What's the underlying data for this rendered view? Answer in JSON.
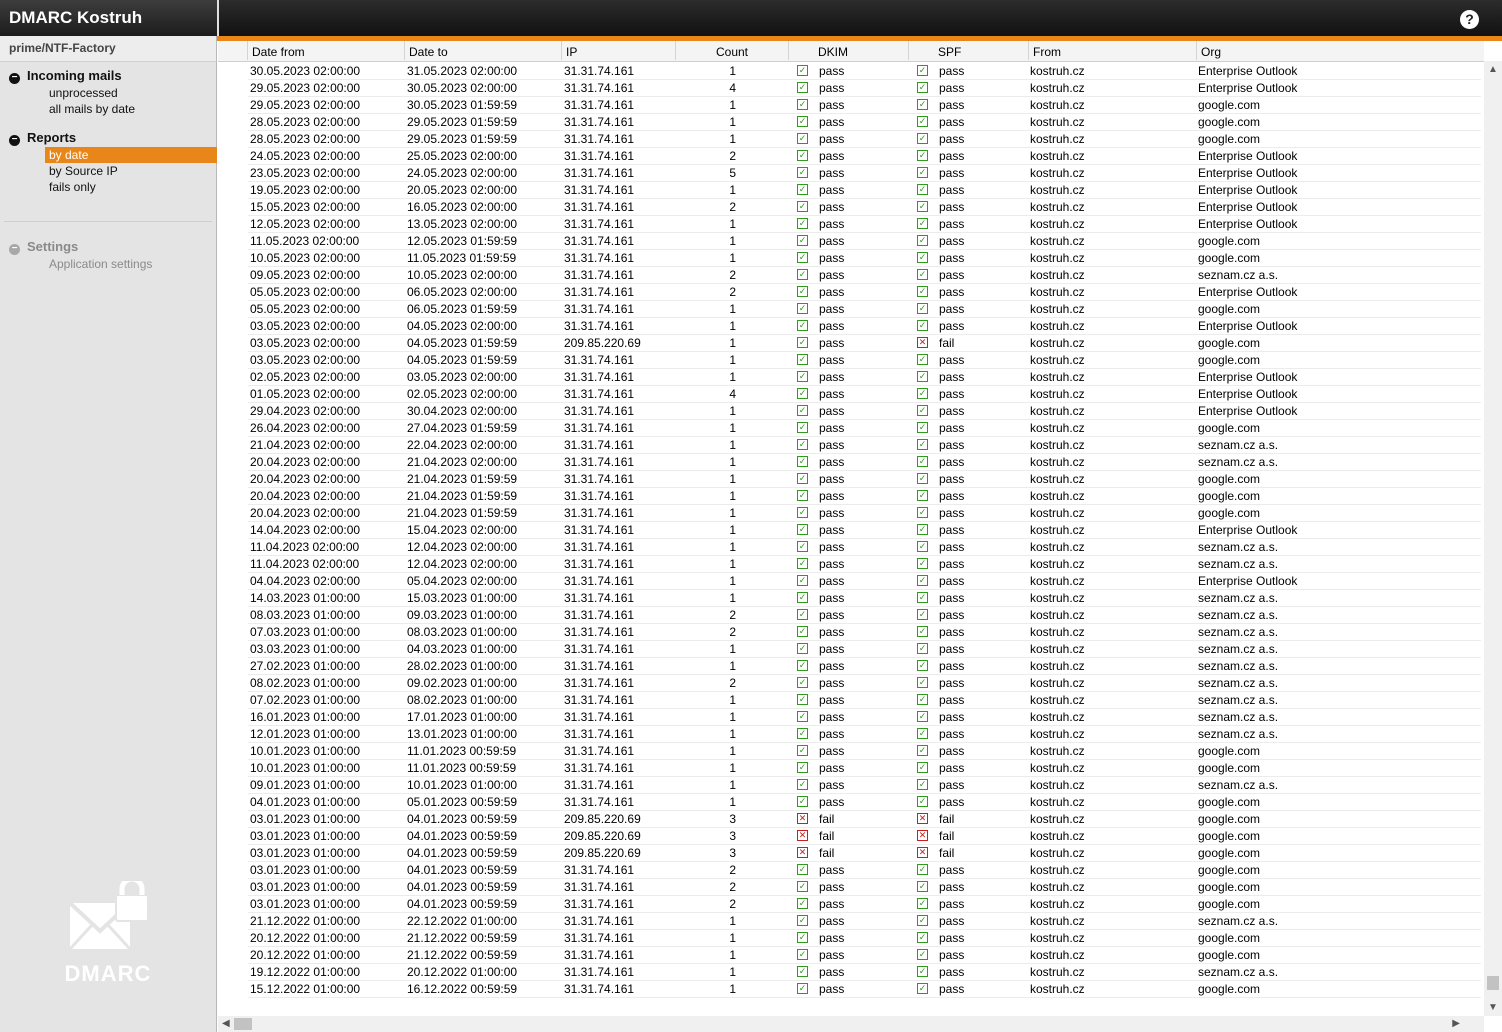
{
  "app": {
    "title": "DMARC Kostruh",
    "help_icon": "question-icon",
    "help_label": "?"
  },
  "sidebar": {
    "account": "prime/NTF-Factory",
    "incoming": {
      "title": "Incoming mails",
      "items": [
        "unprocessed",
        "all mails by date"
      ]
    },
    "reports": {
      "title": "Reports",
      "items": [
        "by date",
        "by Source IP",
        "fails only"
      ],
      "active": "by date"
    },
    "settings": {
      "title": "Settings",
      "items": [
        "Application settings"
      ]
    },
    "logo_text": "DMARC"
  },
  "colors": {
    "accent": "#e8861a",
    "pass": "#2f9a1e",
    "fail": "#c81e1e"
  },
  "table": {
    "columns": [
      "Date from",
      "Date to",
      "IP",
      "Count",
      "DKIM",
      "SPF",
      "From",
      "Org"
    ],
    "rows": [
      [
        "30.05.2023 02:00:00",
        "31.05.2023 02:00:00",
        "31.31.74.161",
        "1",
        "pass",
        "pass",
        "kostruh.cz",
        "Enterprise Outlook"
      ],
      [
        "29.05.2023 02:00:00",
        "30.05.2023 02:00:00",
        "31.31.74.161",
        "4",
        "pass",
        "pass",
        "kostruh.cz",
        "Enterprise Outlook"
      ],
      [
        "29.05.2023 02:00:00",
        "30.05.2023 01:59:59",
        "31.31.74.161",
        "1",
        "pass",
        "pass",
        "kostruh.cz",
        "google.com"
      ],
      [
        "28.05.2023 02:00:00",
        "29.05.2023 01:59:59",
        "31.31.74.161",
        "1",
        "pass",
        "pass",
        "kostruh.cz",
        "google.com"
      ],
      [
        "28.05.2023 02:00:00",
        "29.05.2023 01:59:59",
        "31.31.74.161",
        "1",
        "pass",
        "pass",
        "kostruh.cz",
        "google.com"
      ],
      [
        "24.05.2023 02:00:00",
        "25.05.2023 02:00:00",
        "31.31.74.161",
        "2",
        "pass",
        "pass",
        "kostruh.cz",
        "Enterprise Outlook"
      ],
      [
        "23.05.2023 02:00:00",
        "24.05.2023 02:00:00",
        "31.31.74.161",
        "5",
        "pass",
        "pass",
        "kostruh.cz",
        "Enterprise Outlook"
      ],
      [
        "19.05.2023 02:00:00",
        "20.05.2023 02:00:00",
        "31.31.74.161",
        "1",
        "pass",
        "pass",
        "kostruh.cz",
        "Enterprise Outlook"
      ],
      [
        "15.05.2023 02:00:00",
        "16.05.2023 02:00:00",
        "31.31.74.161",
        "2",
        "pass",
        "pass",
        "kostruh.cz",
        "Enterprise Outlook"
      ],
      [
        "12.05.2023 02:00:00",
        "13.05.2023 02:00:00",
        "31.31.74.161",
        "1",
        "pass",
        "pass",
        "kostruh.cz",
        "Enterprise Outlook"
      ],
      [
        "11.05.2023 02:00:00",
        "12.05.2023 01:59:59",
        "31.31.74.161",
        "1",
        "pass",
        "pass",
        "kostruh.cz",
        "google.com"
      ],
      [
        "10.05.2023 02:00:00",
        "11.05.2023 01:59:59",
        "31.31.74.161",
        "1",
        "pass",
        "pass",
        "kostruh.cz",
        "google.com"
      ],
      [
        "09.05.2023 02:00:00",
        "10.05.2023 02:00:00",
        "31.31.74.161",
        "2",
        "pass",
        "pass",
        "kostruh.cz",
        "seznam.cz a.s."
      ],
      [
        "05.05.2023 02:00:00",
        "06.05.2023 02:00:00",
        "31.31.74.161",
        "2",
        "pass",
        "pass",
        "kostruh.cz",
        "Enterprise Outlook"
      ],
      [
        "05.05.2023 02:00:00",
        "06.05.2023 01:59:59",
        "31.31.74.161",
        "1",
        "pass",
        "pass",
        "kostruh.cz",
        "google.com"
      ],
      [
        "03.05.2023 02:00:00",
        "04.05.2023 02:00:00",
        "31.31.74.161",
        "1",
        "pass",
        "pass",
        "kostruh.cz",
        "Enterprise Outlook"
      ],
      [
        "03.05.2023 02:00:00",
        "04.05.2023 01:59:59",
        "209.85.220.69",
        "1",
        "pass",
        "fail",
        "kostruh.cz",
        "google.com"
      ],
      [
        "03.05.2023 02:00:00",
        "04.05.2023 01:59:59",
        "31.31.74.161",
        "1",
        "pass",
        "pass",
        "kostruh.cz",
        "google.com"
      ],
      [
        "02.05.2023 02:00:00",
        "03.05.2023 02:00:00",
        "31.31.74.161",
        "1",
        "pass",
        "pass",
        "kostruh.cz",
        "Enterprise Outlook"
      ],
      [
        "01.05.2023 02:00:00",
        "02.05.2023 02:00:00",
        "31.31.74.161",
        "4",
        "pass",
        "pass",
        "kostruh.cz",
        "Enterprise Outlook"
      ],
      [
        "29.04.2023 02:00:00",
        "30.04.2023 02:00:00",
        "31.31.74.161",
        "1",
        "pass",
        "pass",
        "kostruh.cz",
        "Enterprise Outlook"
      ],
      [
        "26.04.2023 02:00:00",
        "27.04.2023 01:59:59",
        "31.31.74.161",
        "1",
        "pass",
        "pass",
        "kostruh.cz",
        "google.com"
      ],
      [
        "21.04.2023 02:00:00",
        "22.04.2023 02:00:00",
        "31.31.74.161",
        "1",
        "pass",
        "pass",
        "kostruh.cz",
        "seznam.cz a.s."
      ],
      [
        "20.04.2023 02:00:00",
        "21.04.2023 02:00:00",
        "31.31.74.161",
        "1",
        "pass",
        "pass",
        "kostruh.cz",
        "seznam.cz a.s."
      ],
      [
        "20.04.2023 02:00:00",
        "21.04.2023 01:59:59",
        "31.31.74.161",
        "1",
        "pass",
        "pass",
        "kostruh.cz",
        "google.com"
      ],
      [
        "20.04.2023 02:00:00",
        "21.04.2023 01:59:59",
        "31.31.74.161",
        "1",
        "pass",
        "pass",
        "kostruh.cz",
        "google.com"
      ],
      [
        "20.04.2023 02:00:00",
        "21.04.2023 01:59:59",
        "31.31.74.161",
        "1",
        "pass",
        "pass",
        "kostruh.cz",
        "google.com"
      ],
      [
        "14.04.2023 02:00:00",
        "15.04.2023 02:00:00",
        "31.31.74.161",
        "1",
        "pass",
        "pass",
        "kostruh.cz",
        "Enterprise Outlook"
      ],
      [
        "11.04.2023 02:00:00",
        "12.04.2023 02:00:00",
        "31.31.74.161",
        "1",
        "pass",
        "pass",
        "kostruh.cz",
        "seznam.cz a.s."
      ],
      [
        "11.04.2023 02:00:00",
        "12.04.2023 02:00:00",
        "31.31.74.161",
        "1",
        "pass",
        "pass",
        "kostruh.cz",
        "seznam.cz a.s."
      ],
      [
        "04.04.2023 02:00:00",
        "05.04.2023 02:00:00",
        "31.31.74.161",
        "1",
        "pass",
        "pass",
        "kostruh.cz",
        "Enterprise Outlook"
      ],
      [
        "14.03.2023 01:00:00",
        "15.03.2023 01:00:00",
        "31.31.74.161",
        "1",
        "pass",
        "pass",
        "kostruh.cz",
        "seznam.cz a.s."
      ],
      [
        "08.03.2023 01:00:00",
        "09.03.2023 01:00:00",
        "31.31.74.161",
        "2",
        "pass",
        "pass",
        "kostruh.cz",
        "seznam.cz a.s."
      ],
      [
        "07.03.2023 01:00:00",
        "08.03.2023 01:00:00",
        "31.31.74.161",
        "2",
        "pass",
        "pass",
        "kostruh.cz",
        "seznam.cz a.s."
      ],
      [
        "03.03.2023 01:00:00",
        "04.03.2023 01:00:00",
        "31.31.74.161",
        "1",
        "pass",
        "pass",
        "kostruh.cz",
        "seznam.cz a.s."
      ],
      [
        "27.02.2023 01:00:00",
        "28.02.2023 01:00:00",
        "31.31.74.161",
        "1",
        "pass",
        "pass",
        "kostruh.cz",
        "seznam.cz a.s."
      ],
      [
        "08.02.2023 01:00:00",
        "09.02.2023 01:00:00",
        "31.31.74.161",
        "2",
        "pass",
        "pass",
        "kostruh.cz",
        "seznam.cz a.s."
      ],
      [
        "07.02.2023 01:00:00",
        "08.02.2023 01:00:00",
        "31.31.74.161",
        "1",
        "pass",
        "pass",
        "kostruh.cz",
        "seznam.cz a.s."
      ],
      [
        "16.01.2023 01:00:00",
        "17.01.2023 01:00:00",
        "31.31.74.161",
        "1",
        "pass",
        "pass",
        "kostruh.cz",
        "seznam.cz a.s."
      ],
      [
        "12.01.2023 01:00:00",
        "13.01.2023 01:00:00",
        "31.31.74.161",
        "1",
        "pass",
        "pass",
        "kostruh.cz",
        "seznam.cz a.s."
      ],
      [
        "10.01.2023 01:00:00",
        "11.01.2023 00:59:59",
        "31.31.74.161",
        "1",
        "pass",
        "pass",
        "kostruh.cz",
        "google.com"
      ],
      [
        "10.01.2023 01:00:00",
        "11.01.2023 00:59:59",
        "31.31.74.161",
        "1",
        "pass",
        "pass",
        "kostruh.cz",
        "google.com"
      ],
      [
        "09.01.2023 01:00:00",
        "10.01.2023 01:00:00",
        "31.31.74.161",
        "1",
        "pass",
        "pass",
        "kostruh.cz",
        "seznam.cz a.s."
      ],
      [
        "04.01.2023 01:00:00",
        "05.01.2023 00:59:59",
        "31.31.74.161",
        "1",
        "pass",
        "pass",
        "kostruh.cz",
        "google.com"
      ],
      [
        "03.01.2023 01:00:00",
        "04.01.2023 00:59:59",
        "209.85.220.69",
        "3",
        "fail",
        "fail",
        "kostruh.cz",
        "google.com"
      ],
      [
        "03.01.2023 01:00:00",
        "04.01.2023 00:59:59",
        "209.85.220.69",
        "3",
        "fail",
        "fail",
        "kostruh.cz",
        "google.com"
      ],
      [
        "03.01.2023 01:00:00",
        "04.01.2023 00:59:59",
        "209.85.220.69",
        "3",
        "fail",
        "fail",
        "kostruh.cz",
        "google.com"
      ],
      [
        "03.01.2023 01:00:00",
        "04.01.2023 00:59:59",
        "31.31.74.161",
        "2",
        "pass",
        "pass",
        "kostruh.cz",
        "google.com"
      ],
      [
        "03.01.2023 01:00:00",
        "04.01.2023 00:59:59",
        "31.31.74.161",
        "2",
        "pass",
        "pass",
        "kostruh.cz",
        "google.com"
      ],
      [
        "03.01.2023 01:00:00",
        "04.01.2023 00:59:59",
        "31.31.74.161",
        "2",
        "pass",
        "pass",
        "kostruh.cz",
        "google.com"
      ],
      [
        "21.12.2022 01:00:00",
        "22.12.2022 01:00:00",
        "31.31.74.161",
        "1",
        "pass",
        "pass",
        "kostruh.cz",
        "seznam.cz a.s."
      ],
      [
        "20.12.2022 01:00:00",
        "21.12.2022 00:59:59",
        "31.31.74.161",
        "1",
        "pass",
        "pass",
        "kostruh.cz",
        "google.com"
      ],
      [
        "20.12.2022 01:00:00",
        "21.12.2022 00:59:59",
        "31.31.74.161",
        "1",
        "pass",
        "pass",
        "kostruh.cz",
        "google.com"
      ],
      [
        "19.12.2022 01:00:00",
        "20.12.2022 01:00:00",
        "31.31.74.161",
        "1",
        "pass",
        "pass",
        "kostruh.cz",
        "seznam.cz a.s."
      ],
      [
        "15.12.2022 01:00:00",
        "16.12.2022 00:59:59",
        "31.31.74.161",
        "1",
        "pass",
        "pass",
        "kostruh.cz",
        "google.com"
      ]
    ]
  }
}
